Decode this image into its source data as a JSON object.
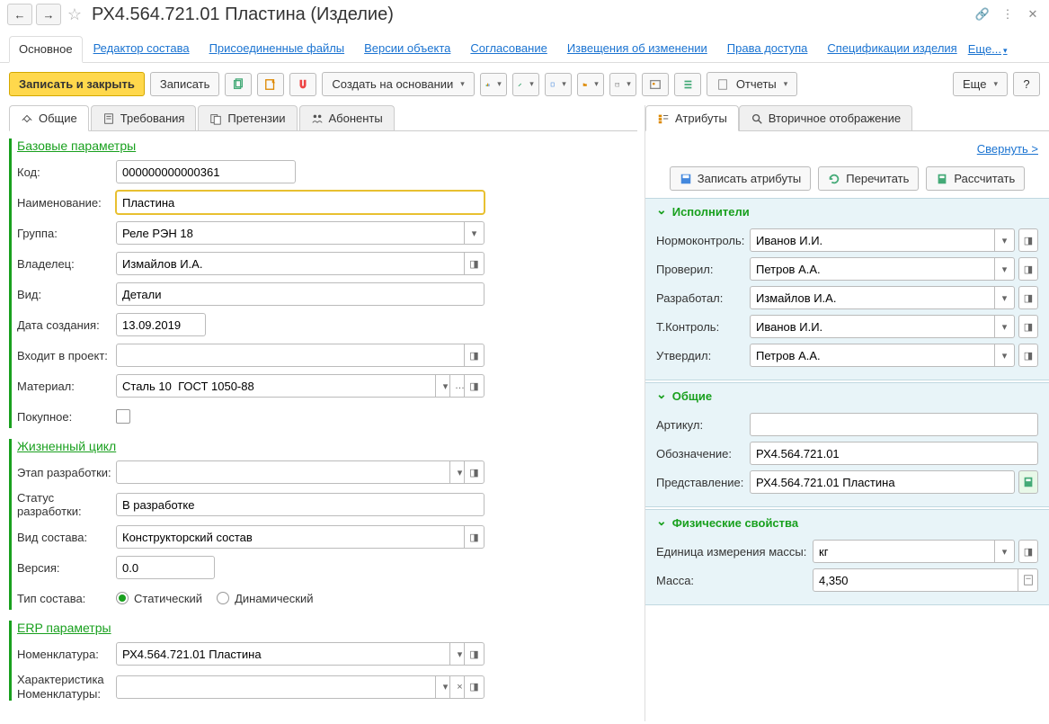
{
  "title": "РХ4.564.721.01 Пластина (Изделие)",
  "nav": {
    "main": "Основное",
    "editor": "Редактор состава",
    "files": "Присоединенные файлы",
    "versions": "Версии объекта",
    "approval": "Согласование",
    "notices": "Извещения об изменении",
    "access": "Права доступа",
    "specs": "Спецификации изделия",
    "more": "Еще..."
  },
  "toolbar": {
    "save_close": "Записать и закрыть",
    "save": "Записать",
    "create_based": "Создать на основании",
    "reports": "Отчеты",
    "more": "Еще"
  },
  "subtabs": {
    "general": "Общие",
    "requirements": "Требования",
    "claims": "Претензии",
    "subscribers": "Абоненты"
  },
  "sections": {
    "base": {
      "title": "Базовые параметры",
      "code_label": "Код:",
      "code": "000000000000361",
      "name_label": "Наименование:",
      "name": "Пластина",
      "group_label": "Группа:",
      "group": "Реле РЭН 18",
      "owner_label": "Владелец:",
      "owner": "Измайлов И.А.",
      "type_label": "Вид:",
      "type": "Детали",
      "date_label": "Дата создания:",
      "date": "13.09.2019",
      "project_label": "Входит в проект:",
      "project": "",
      "material_label": "Материал:",
      "material": "Сталь 10  ГОСТ 1050-88",
      "purchased_label": "Покупное:"
    },
    "lifecycle": {
      "title": "Жизненный цикл",
      "stage_label": "Этап разработки:",
      "stage": "",
      "status_label": "Статус разработки:",
      "status": "В разработке",
      "composition_label": "Вид состава:",
      "composition": "Конструкторский состав",
      "version_label": "Версия:",
      "version": "0.0",
      "comp_type_label": "Тип состава:",
      "static": "Статический",
      "dynamic": "Динамический"
    },
    "erp": {
      "title": "ERP параметры",
      "nomenclature_label": "Номенклатура:",
      "nomenclature": "РХ4.564.721.01 Пластина",
      "characteristic_label": "Характеристика Номенклатуры:",
      "characteristic": ""
    }
  },
  "right": {
    "tab_attrs": "Атрибуты",
    "tab_secondary": "Вторичное отображение",
    "collapse": "Свернуть >",
    "save_attrs": "Записать атрибуты",
    "reread": "Перечитать",
    "calculate": "Рассчитать",
    "performers": {
      "title": "Исполнители",
      "norm_label": "Нормоконтроль:",
      "norm": "Иванов И.И.",
      "checked_label": "Проверил:",
      "checked": "Петров А.А.",
      "developed_label": "Разработал:",
      "developed": "Измайлов И.А.",
      "tcontrol_label": "Т.Контроль:",
      "tcontrol": "Иванов И.И.",
      "approved_label": "Утвердил:",
      "approved": "Петров А.А."
    },
    "general": {
      "title": "Общие",
      "article_label": "Артикул:",
      "article": "",
      "designation_label": "Обозначение:",
      "designation": "РХ4.564.721.01",
      "representation_label": "Представление:",
      "representation": "РХ4.564.721.01 Пластина"
    },
    "physical": {
      "title": "Физические свойства",
      "unit_label": "Единица измерения массы:",
      "unit": "кг",
      "mass_label": "Масса:",
      "mass": "4,350"
    }
  }
}
